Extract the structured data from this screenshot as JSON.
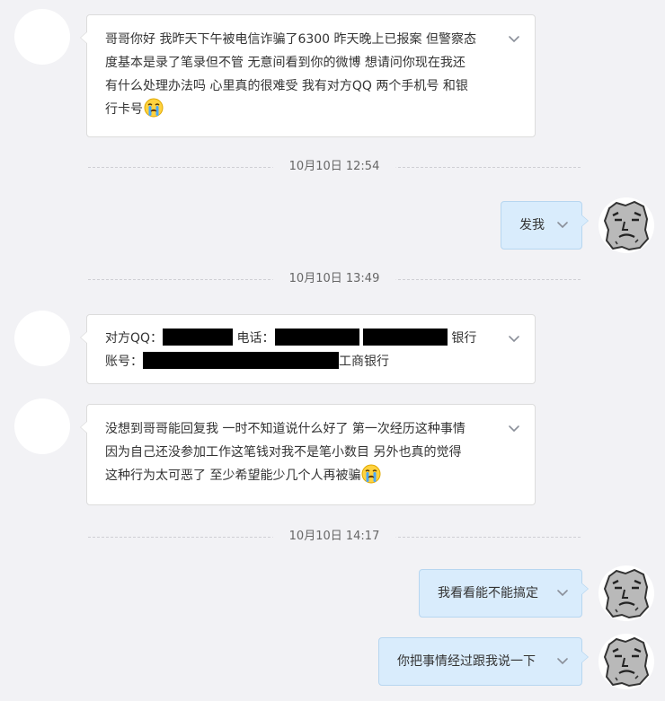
{
  "messages": [
    {
      "lines": [
        "哥哥你好 我昨天下午被电信诈骗了6300 昨天晚上已报案 但警察态",
        "度基本是录了笔录但不管 无意间看到你的微博 想请问你现在我还",
        "有什么处理办法吗 心里真的很难受 我有对方QQ 两个手机号 和银",
        "行卡号"
      ],
      "emoji": "crying-face-icon"
    },
    {
      "timestamp": "10月10日 12:54"
    },
    {
      "reply": "发我"
    },
    {
      "timestamp": "10月10日 13:49"
    },
    {
      "qq_label": "对方QQ：",
      "phone_label": "电话：",
      "bank_suffix": "银行",
      "account_label": "账号：",
      "bank_name": "工商银行"
    },
    {
      "lines": [
        "没想到哥哥能回复我 一时不知道说什么好了 第一次经历这种事情",
        "因为自己还没参加工作这笔钱对我不是笔小数目 另外也真的觉得",
        "这种行为太可恶了 至少希望能少几个人再被骗"
      ],
      "emoji": "crying-face-icon"
    },
    {
      "timestamp": "10月10日 14:17"
    },
    {
      "reply": "我看看能不能搞定"
    },
    {
      "reply": "你把事情经过跟我说一下"
    }
  ],
  "colors": {
    "background": "#f2f2f5",
    "incoming_bubble": "#ffffff",
    "outgoing_bubble": "#d9ecfc",
    "redaction": "#000000"
  }
}
